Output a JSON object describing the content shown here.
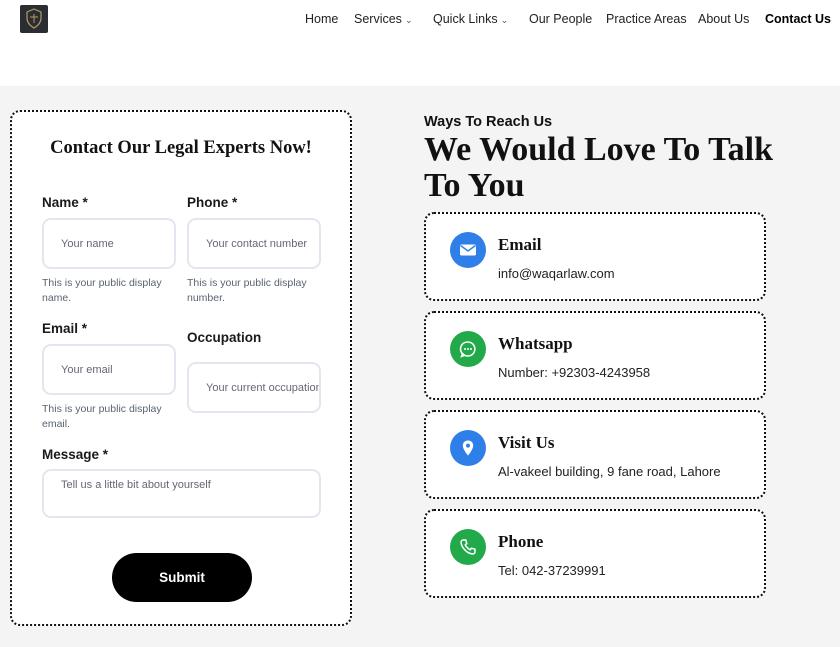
{
  "nav": {
    "items": [
      {
        "label": "Home"
      },
      {
        "label": "Services",
        "dropdown": true
      },
      {
        "label": "Quick Links",
        "dropdown": true
      },
      {
        "label": "Our People"
      },
      {
        "label": "Practice Areas"
      },
      {
        "label": "About Us"
      },
      {
        "label": "Contact Us",
        "active": true
      }
    ],
    "logo_icon": "law-firm-logo-icon"
  },
  "form": {
    "title": "Contact Our Legal Experts Now!",
    "name": {
      "label": "Name *",
      "placeholder": "Your name",
      "help": "This is your public display name."
    },
    "phone": {
      "label": "Phone *",
      "placeholder": "Your contact number",
      "help": "This is your public display number."
    },
    "email": {
      "label": "Email *",
      "placeholder": "Your email",
      "help": "This is your public display email."
    },
    "occupation": {
      "label": "Occupation",
      "placeholder": "Your current occupation"
    },
    "message": {
      "label": "Message *",
      "placeholder": "Tell us a little bit about yourself"
    },
    "submit_label": "Submit"
  },
  "reach": {
    "kicker": "Ways To Reach Us",
    "heading": "We Would Love To Talk To You",
    "cards": [
      {
        "title": "Email",
        "value": "info@waqarlaw.com",
        "icon": "envelope-icon",
        "color": "#2f7fe8"
      },
      {
        "title": "Whatsapp",
        "value": "Number: +92303-4243958",
        "icon": "chat-bubble-icon",
        "color": "#22a94a"
      },
      {
        "title": "Visit Us",
        "value": "Al-vakeel building, 9 fane road, Lahore",
        "icon": "map-pin-icon",
        "color": "#2f7fe8"
      },
      {
        "title": "Phone",
        "value": "Tel: 042-37239991",
        "icon": "phone-icon",
        "color": "#22a94a"
      }
    ]
  }
}
